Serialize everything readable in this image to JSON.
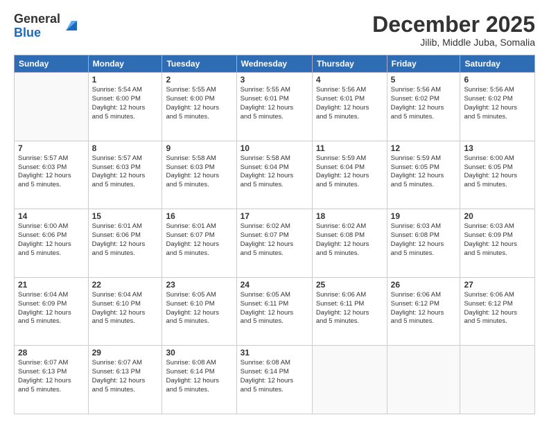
{
  "header": {
    "logo_general": "General",
    "logo_blue": "Blue",
    "title": "December 2025",
    "subtitle": "Jilib, Middle Juba, Somalia"
  },
  "columns": [
    "Sunday",
    "Monday",
    "Tuesday",
    "Wednesday",
    "Thursday",
    "Friday",
    "Saturday"
  ],
  "weeks": [
    [
      {
        "day": "",
        "detail": ""
      },
      {
        "day": "1",
        "detail": "Sunrise: 5:54 AM\nSunset: 6:00 PM\nDaylight: 12 hours\nand 5 minutes."
      },
      {
        "day": "2",
        "detail": "Sunrise: 5:55 AM\nSunset: 6:00 PM\nDaylight: 12 hours\nand 5 minutes."
      },
      {
        "day": "3",
        "detail": "Sunrise: 5:55 AM\nSunset: 6:01 PM\nDaylight: 12 hours\nand 5 minutes."
      },
      {
        "day": "4",
        "detail": "Sunrise: 5:56 AM\nSunset: 6:01 PM\nDaylight: 12 hours\nand 5 minutes."
      },
      {
        "day": "5",
        "detail": "Sunrise: 5:56 AM\nSunset: 6:02 PM\nDaylight: 12 hours\nand 5 minutes."
      },
      {
        "day": "6",
        "detail": "Sunrise: 5:56 AM\nSunset: 6:02 PM\nDaylight: 12 hours\nand 5 minutes."
      }
    ],
    [
      {
        "day": "7",
        "detail": "Sunrise: 5:57 AM\nSunset: 6:03 PM\nDaylight: 12 hours\nand 5 minutes."
      },
      {
        "day": "8",
        "detail": "Sunrise: 5:57 AM\nSunset: 6:03 PM\nDaylight: 12 hours\nand 5 minutes."
      },
      {
        "day": "9",
        "detail": "Sunrise: 5:58 AM\nSunset: 6:03 PM\nDaylight: 12 hours\nand 5 minutes."
      },
      {
        "day": "10",
        "detail": "Sunrise: 5:58 AM\nSunset: 6:04 PM\nDaylight: 12 hours\nand 5 minutes."
      },
      {
        "day": "11",
        "detail": "Sunrise: 5:59 AM\nSunset: 6:04 PM\nDaylight: 12 hours\nand 5 minutes."
      },
      {
        "day": "12",
        "detail": "Sunrise: 5:59 AM\nSunset: 6:05 PM\nDaylight: 12 hours\nand 5 minutes."
      },
      {
        "day": "13",
        "detail": "Sunrise: 6:00 AM\nSunset: 6:05 PM\nDaylight: 12 hours\nand 5 minutes."
      }
    ],
    [
      {
        "day": "14",
        "detail": "Sunrise: 6:00 AM\nSunset: 6:06 PM\nDaylight: 12 hours\nand 5 minutes."
      },
      {
        "day": "15",
        "detail": "Sunrise: 6:01 AM\nSunset: 6:06 PM\nDaylight: 12 hours\nand 5 minutes."
      },
      {
        "day": "16",
        "detail": "Sunrise: 6:01 AM\nSunset: 6:07 PM\nDaylight: 12 hours\nand 5 minutes."
      },
      {
        "day": "17",
        "detail": "Sunrise: 6:02 AM\nSunset: 6:07 PM\nDaylight: 12 hours\nand 5 minutes."
      },
      {
        "day": "18",
        "detail": "Sunrise: 6:02 AM\nSunset: 6:08 PM\nDaylight: 12 hours\nand 5 minutes."
      },
      {
        "day": "19",
        "detail": "Sunrise: 6:03 AM\nSunset: 6:08 PM\nDaylight: 12 hours\nand 5 minutes."
      },
      {
        "day": "20",
        "detail": "Sunrise: 6:03 AM\nSunset: 6:09 PM\nDaylight: 12 hours\nand 5 minutes."
      }
    ],
    [
      {
        "day": "21",
        "detail": "Sunrise: 6:04 AM\nSunset: 6:09 PM\nDaylight: 12 hours\nand 5 minutes."
      },
      {
        "day": "22",
        "detail": "Sunrise: 6:04 AM\nSunset: 6:10 PM\nDaylight: 12 hours\nand 5 minutes."
      },
      {
        "day": "23",
        "detail": "Sunrise: 6:05 AM\nSunset: 6:10 PM\nDaylight: 12 hours\nand 5 minutes."
      },
      {
        "day": "24",
        "detail": "Sunrise: 6:05 AM\nSunset: 6:11 PM\nDaylight: 12 hours\nand 5 minutes."
      },
      {
        "day": "25",
        "detail": "Sunrise: 6:06 AM\nSunset: 6:11 PM\nDaylight: 12 hours\nand 5 minutes."
      },
      {
        "day": "26",
        "detail": "Sunrise: 6:06 AM\nSunset: 6:12 PM\nDaylight: 12 hours\nand 5 minutes."
      },
      {
        "day": "27",
        "detail": "Sunrise: 6:06 AM\nSunset: 6:12 PM\nDaylight: 12 hours\nand 5 minutes."
      }
    ],
    [
      {
        "day": "28",
        "detail": "Sunrise: 6:07 AM\nSunset: 6:13 PM\nDaylight: 12 hours\nand 5 minutes."
      },
      {
        "day": "29",
        "detail": "Sunrise: 6:07 AM\nSunset: 6:13 PM\nDaylight: 12 hours\nand 5 minutes."
      },
      {
        "day": "30",
        "detail": "Sunrise: 6:08 AM\nSunset: 6:14 PM\nDaylight: 12 hours\nand 5 minutes."
      },
      {
        "day": "31",
        "detail": "Sunrise: 6:08 AM\nSunset: 6:14 PM\nDaylight: 12 hours\nand 5 minutes."
      },
      {
        "day": "",
        "detail": ""
      },
      {
        "day": "",
        "detail": ""
      },
      {
        "day": "",
        "detail": ""
      }
    ]
  ]
}
